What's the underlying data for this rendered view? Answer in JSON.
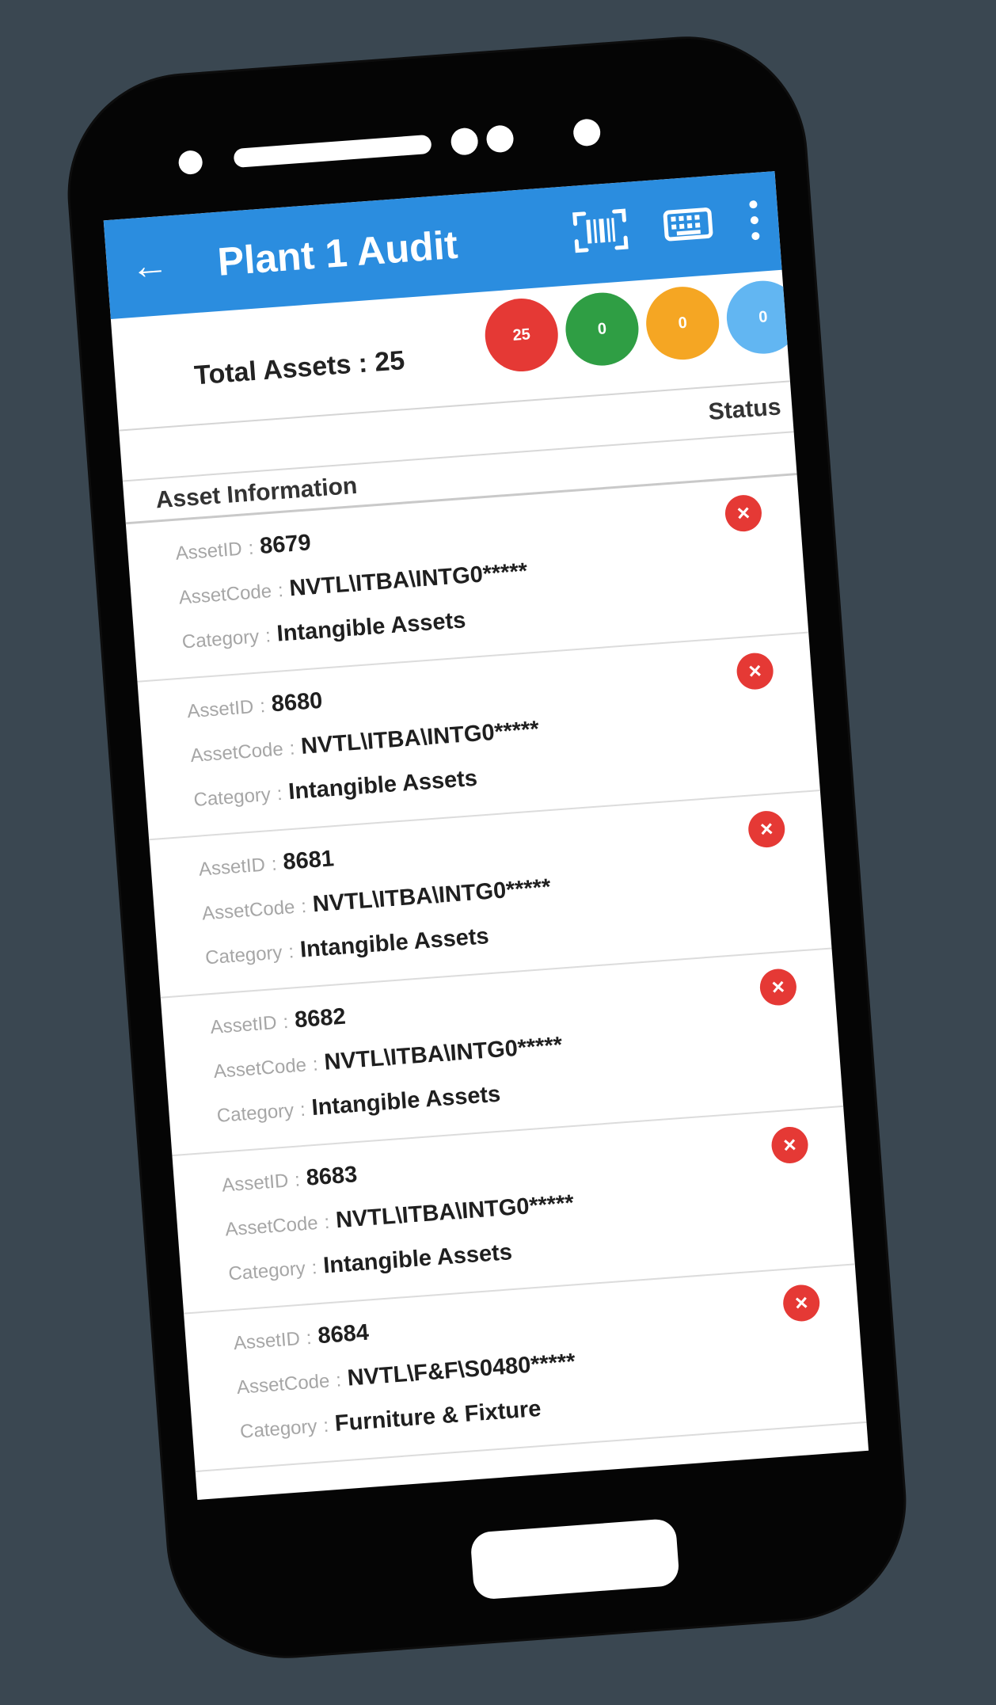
{
  "header": {
    "back_label": "←",
    "title": "Plant 1 Audit",
    "icons": [
      "barcode-icon",
      "keyboard-icon",
      "more-icon"
    ]
  },
  "summary": {
    "total_label": "Total Assets : 25",
    "counts": [
      {
        "value": "25",
        "color": "#e53935"
      },
      {
        "value": "0",
        "color": "#2f9e44"
      },
      {
        "value": "0",
        "color": "#f5a623"
      },
      {
        "value": "0",
        "color": "#62b6f2"
      }
    ]
  },
  "table": {
    "status_header": "Status",
    "info_header": "Asset Information",
    "labels": {
      "asset_id": "AssetID",
      "asset_code": "AssetCode",
      "category": "Category",
      "separator": ":"
    },
    "rows": [
      {
        "id": "8679",
        "code": "NVTL\\ITBA\\INTG0*****",
        "category": "Intangible Assets",
        "status_icon": "close-icon"
      },
      {
        "id": "8680",
        "code": "NVTL\\ITBA\\INTG0*****",
        "category": "Intangible Assets",
        "status_icon": "close-icon"
      },
      {
        "id": "8681",
        "code": "NVTL\\ITBA\\INTG0*****",
        "category": "Intangible Assets",
        "status_icon": "close-icon"
      },
      {
        "id": "8682",
        "code": "NVTL\\ITBA\\INTG0*****",
        "category": "Intangible Assets",
        "status_icon": "close-icon"
      },
      {
        "id": "8683",
        "code": "NVTL\\ITBA\\INTG0*****",
        "category": "Intangible Assets",
        "status_icon": "close-icon"
      },
      {
        "id": "8684",
        "code": "NVTL\\F&F\\S0480*****",
        "category": "Furniture & Fixture",
        "status_icon": "close-icon"
      }
    ]
  },
  "colors": {
    "appbar": "#2b8ddf",
    "background": "#3a4751",
    "status_error": "#e53935"
  }
}
